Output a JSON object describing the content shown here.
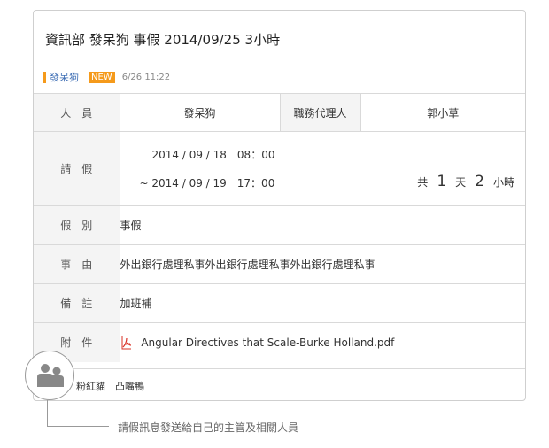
{
  "post": {
    "title": "資訊部 發呆狗 事假 2014/09/25 3小時",
    "author": "發呆狗",
    "badge": "NEW",
    "datetime": "6/26 11:22"
  },
  "form": {
    "person_label": "人　員",
    "person_value": "發呆狗",
    "agent_label": "職務代理人",
    "agent_value": "郭小草",
    "leave_label": "請　假",
    "leave_start": "2014 / 09 / 18　08：00",
    "leave_end": "~ 2014 / 09 / 19　17：00",
    "total_prefix": "共",
    "total_days": "1",
    "days_unit": "天",
    "total_hours": "2",
    "hours_unit": "小時",
    "type_label": "假　別",
    "type_value": "事假",
    "reason_label": "事　由",
    "reason_value": "外出銀行處理私事外出銀行處理私事外出銀行處理私事",
    "note_label": "備　註",
    "note_value": "加班補",
    "attach_label": "附　件",
    "attach_file": "Angular Directives that Scale-Burke Holland.pdf"
  },
  "recipients": {
    "text": "粉紅貓　凸嘴鴨"
  },
  "callout": {
    "text": "請假訊息發送給自己的主管及相關人員"
  },
  "colors": {
    "accent": "#f59a1b",
    "author": "#3f6fb5",
    "label_bg": "#f4f4f4",
    "border": "#d9d9d9",
    "pdf_red": "#d93025"
  }
}
